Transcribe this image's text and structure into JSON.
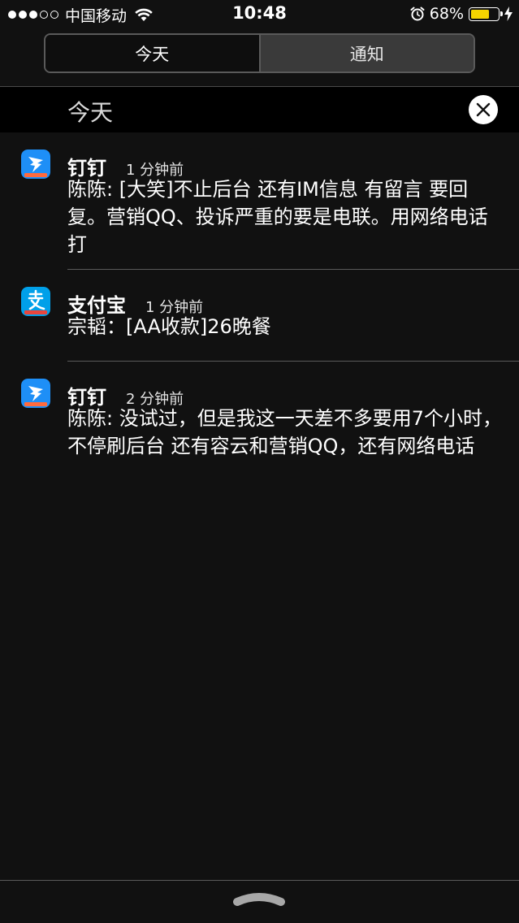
{
  "status_bar": {
    "signal_dots_full": 3,
    "signal_dots_empty": 2,
    "carrier": "中国移动",
    "time": "10:48",
    "battery_percent": "68%",
    "battery_level": 0.68,
    "battery_color": "#f5d300",
    "icons": [
      "wifi-icon",
      "alarm-icon",
      "battery-icon",
      "charging-bolt-icon"
    ]
  },
  "segmented_control": {
    "tabs": [
      {
        "label": "今天",
        "selected": true
      },
      {
        "label": "通知",
        "selected": false
      }
    ]
  },
  "section": {
    "title": "今天",
    "clear_icon": "close-icon"
  },
  "notifications": [
    {
      "app": "钉钉",
      "icon": "dingtalk-icon",
      "time": "1 分钟前",
      "body": "陈陈: [大笑]不止后台  还有IM信息 有留言 要回复。营销QQ、投诉严重的要是电联。用网络电话打"
    },
    {
      "app": "支付宝",
      "icon": "alipay-icon",
      "time": "1 分钟前",
      "body": "宗韬：[AA收款]26晚餐"
    },
    {
      "app": "钉钉",
      "icon": "dingtalk-icon",
      "time": "2 分钟前",
      "body": "陈陈: 没试过，但是我这一天差不多要用7个小时，不停刷后台 还有容云和营销QQ，还有网络电话"
    }
  ],
  "colors": {
    "background": "#111111",
    "header_band": "#000000",
    "dingtalk_blue": "#1e8ff7",
    "alipay_blue": "#00a0e9"
  }
}
